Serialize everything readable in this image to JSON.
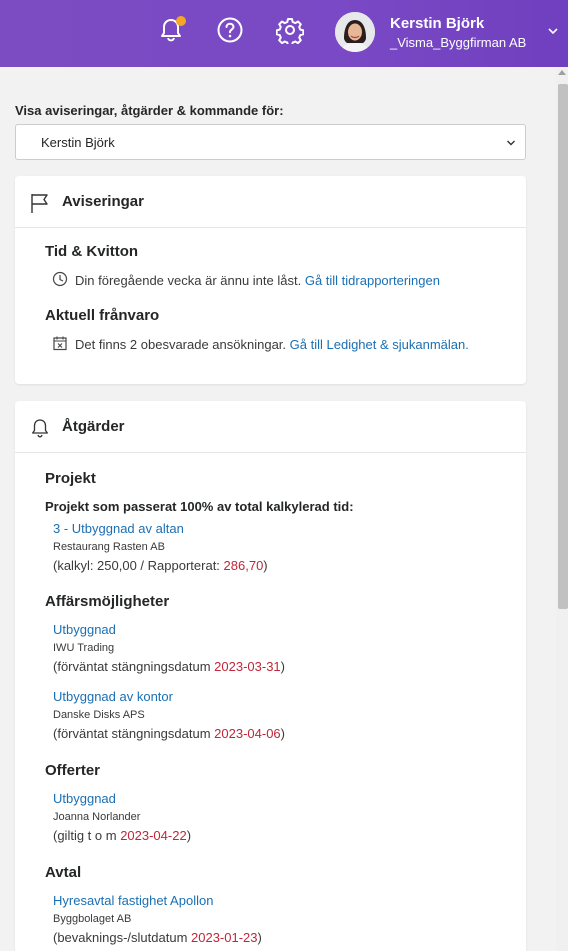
{
  "user": {
    "name": "Kerstin Björk",
    "company": "_Visma_Byggfirman AB"
  },
  "icons": {
    "notifications": "bell-icon",
    "help": "help-circle-icon",
    "settings": "gear-icon",
    "menu": "chevron-down-icon"
  },
  "colors": {
    "header": "#7b4cc2",
    "link": "#1b6fb3",
    "date": "#c0263a",
    "badge": "#f5a623"
  },
  "filter": {
    "label": "Visa aviseringar, åtgärder & kommande för:",
    "selected": "Kerstin Björk"
  },
  "notifications": {
    "title": "Aviseringar",
    "time": {
      "heading": "Tid & Kvitton",
      "text": "Din föregående vecka är ännu inte låst.",
      "link": "Gå till tidrapporteringen"
    },
    "absence": {
      "heading": "Aktuell frånvaro",
      "text": "Det finns 2 obesvarade ansökningar.",
      "link": "Gå till Ledighet & sjukanmälan."
    }
  },
  "actions": {
    "title": "Åtgärder",
    "projects": {
      "heading": "Projekt",
      "subheading": "Projekt som passerat 100% av total kalkylerad tid:",
      "items": [
        {
          "name": "3 - Utbyggnad av altan",
          "customer": "Restaurang Rasten AB",
          "prefix": "(kalkyl: 250,00 / Rapporterat: ",
          "value": "286,70",
          "suffix": ")"
        }
      ]
    },
    "opportunities": {
      "heading": "Affärsmöjligheter",
      "items": [
        {
          "name": "Utbyggnad",
          "customer": "IWU Trading",
          "prefix": "(förväntat stängningsdatum ",
          "date": "2023-03-31",
          "suffix": ")"
        },
        {
          "name": "Utbyggnad av kontor",
          "customer": "Danske Disks APS",
          "prefix": "(förväntat stängningsdatum ",
          "date": "2023-04-06",
          "suffix": ")"
        }
      ]
    },
    "quotes": {
      "heading": "Offerter",
      "items": [
        {
          "name": "Utbyggnad",
          "customer": "Joanna Norlander",
          "prefix": "(giltig t o m ",
          "date": "2023-04-22",
          "suffix": ")"
        }
      ]
    },
    "contracts": {
      "heading": "Avtal",
      "items": [
        {
          "name": "Hyresavtal fastighet Apollon",
          "customer": "Byggbolaget AB",
          "prefix": "(bevaknings-/slutdatum ",
          "date": "2023-01-23",
          "suffix": ")"
        }
      ]
    }
  }
}
